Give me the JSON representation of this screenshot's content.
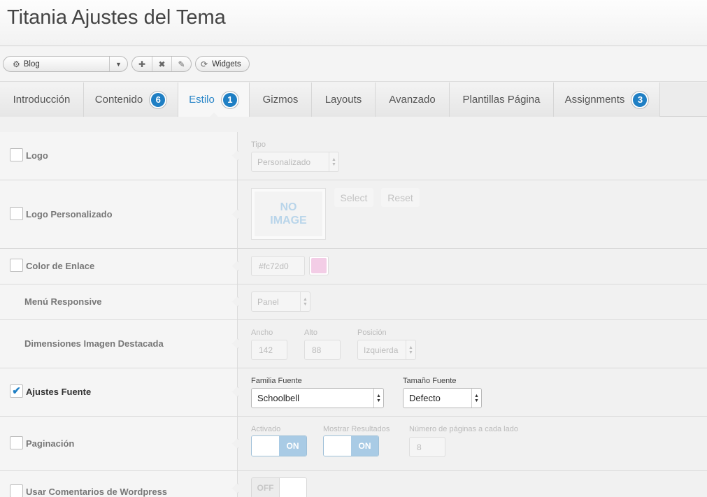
{
  "page": {
    "title": "Titania Ajustes del Tema"
  },
  "toolbar": {
    "layout_select": {
      "icon": "gear-icon",
      "value": "Blog"
    },
    "icon_buttons": [
      "add-icon",
      "delete-icon",
      "edit-icon"
    ],
    "widgets_label": "Widgets"
  },
  "tabs": [
    {
      "label": "Introducción"
    },
    {
      "label": "Contenido",
      "badge": "6"
    },
    {
      "label": "Estilo",
      "badge": "1",
      "active": true
    },
    {
      "label": "Gizmos"
    },
    {
      "label": "Layouts"
    },
    {
      "label": "Avanzado"
    },
    {
      "label": "Plantillas Página"
    },
    {
      "label": "Assignments",
      "badge": "3"
    }
  ],
  "rows": {
    "logo": {
      "label": "Logo",
      "checked": false,
      "type_label": "Tipo",
      "type_value": "Personalizado"
    },
    "custom_logo": {
      "label": "Logo Personalizado",
      "checked": false,
      "placeholder_line1": "NO",
      "placeholder_line2": "IMAGE",
      "select_label": "Select",
      "reset_label": "Reset"
    },
    "link_color": {
      "label": "Color de Enlace",
      "checked": false,
      "value": "#fc72d0",
      "swatch_color": "#f3cde6"
    },
    "responsive_menu": {
      "label": "Menú Responsive",
      "value": "Panel"
    },
    "featured_image": {
      "label": "Dimensiones Imagen Destacada",
      "width_label": "Ancho",
      "width_value": "142",
      "height_label": "Alto",
      "height_value": "88",
      "position_label": "Posición",
      "position_value": "Izquierda"
    },
    "font_settings": {
      "label": "Ajustes Fuente",
      "checked": true,
      "check_mark": "✔",
      "family_label": "Familia Fuente",
      "family_value": "Schoolbell",
      "size_label": "Tamaño Fuente",
      "size_value": "Defecto"
    },
    "pagination": {
      "label": "Paginación",
      "checked": false,
      "enabled_label": "Activado",
      "enabled_value": "ON",
      "results_label": "Mostrar Resultados",
      "results_value": "ON",
      "pages_label": "Número de páginas a cada lado",
      "pages_value": "8"
    },
    "wp_comments": {
      "label": "Usar Comentarios de Wordpress",
      "checked": false,
      "toggle_value": "OFF"
    }
  }
}
